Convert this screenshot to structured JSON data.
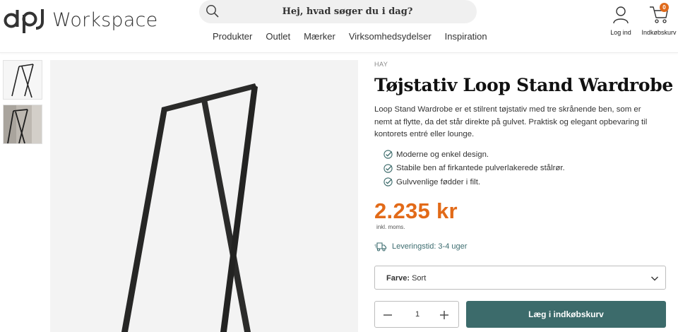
{
  "header": {
    "logo_text": "Workspace",
    "search": {
      "placeholder": "Hej, hvad søger du i dag?"
    },
    "nav": [
      "Produkter",
      "Outlet",
      "Mærker",
      "Virksomhedsydelser",
      "Inspiration"
    ],
    "account_label": "Log ind",
    "cart_label": "Indkøbskurv",
    "cart_count": "0"
  },
  "gallery": {
    "thumbnails": [
      "product-frame-thumbnail",
      "product-room-thumbnail"
    ]
  },
  "product": {
    "brand": "HAY",
    "title": "Tøjstativ Loop Stand Wardrobe",
    "description": "Loop Stand Wardrobe er et stilrent tøjstativ med tre skrånende ben, som er nemt at flytte, da det står direkte på gulvet. Praktisk og elegant opbevaring til kontorets entré eller lounge.",
    "features": [
      "Moderne og enkel design.",
      "Stabile ben af firkantede pulverlakerede stålrør.",
      "Gulvvenlige fødder i filt."
    ],
    "price": "2.235 kr",
    "vat_note": "inkl. moms.",
    "delivery": "Leveringstid: 3-4 uger",
    "color_label": "Farve:",
    "color_value": "Sort",
    "quantity": "1",
    "add_to_cart": "Læg i indkøbskurv"
  },
  "colors": {
    "price": "#e26a18",
    "accent": "#3c6b6b",
    "badge": "#e06a1b"
  }
}
